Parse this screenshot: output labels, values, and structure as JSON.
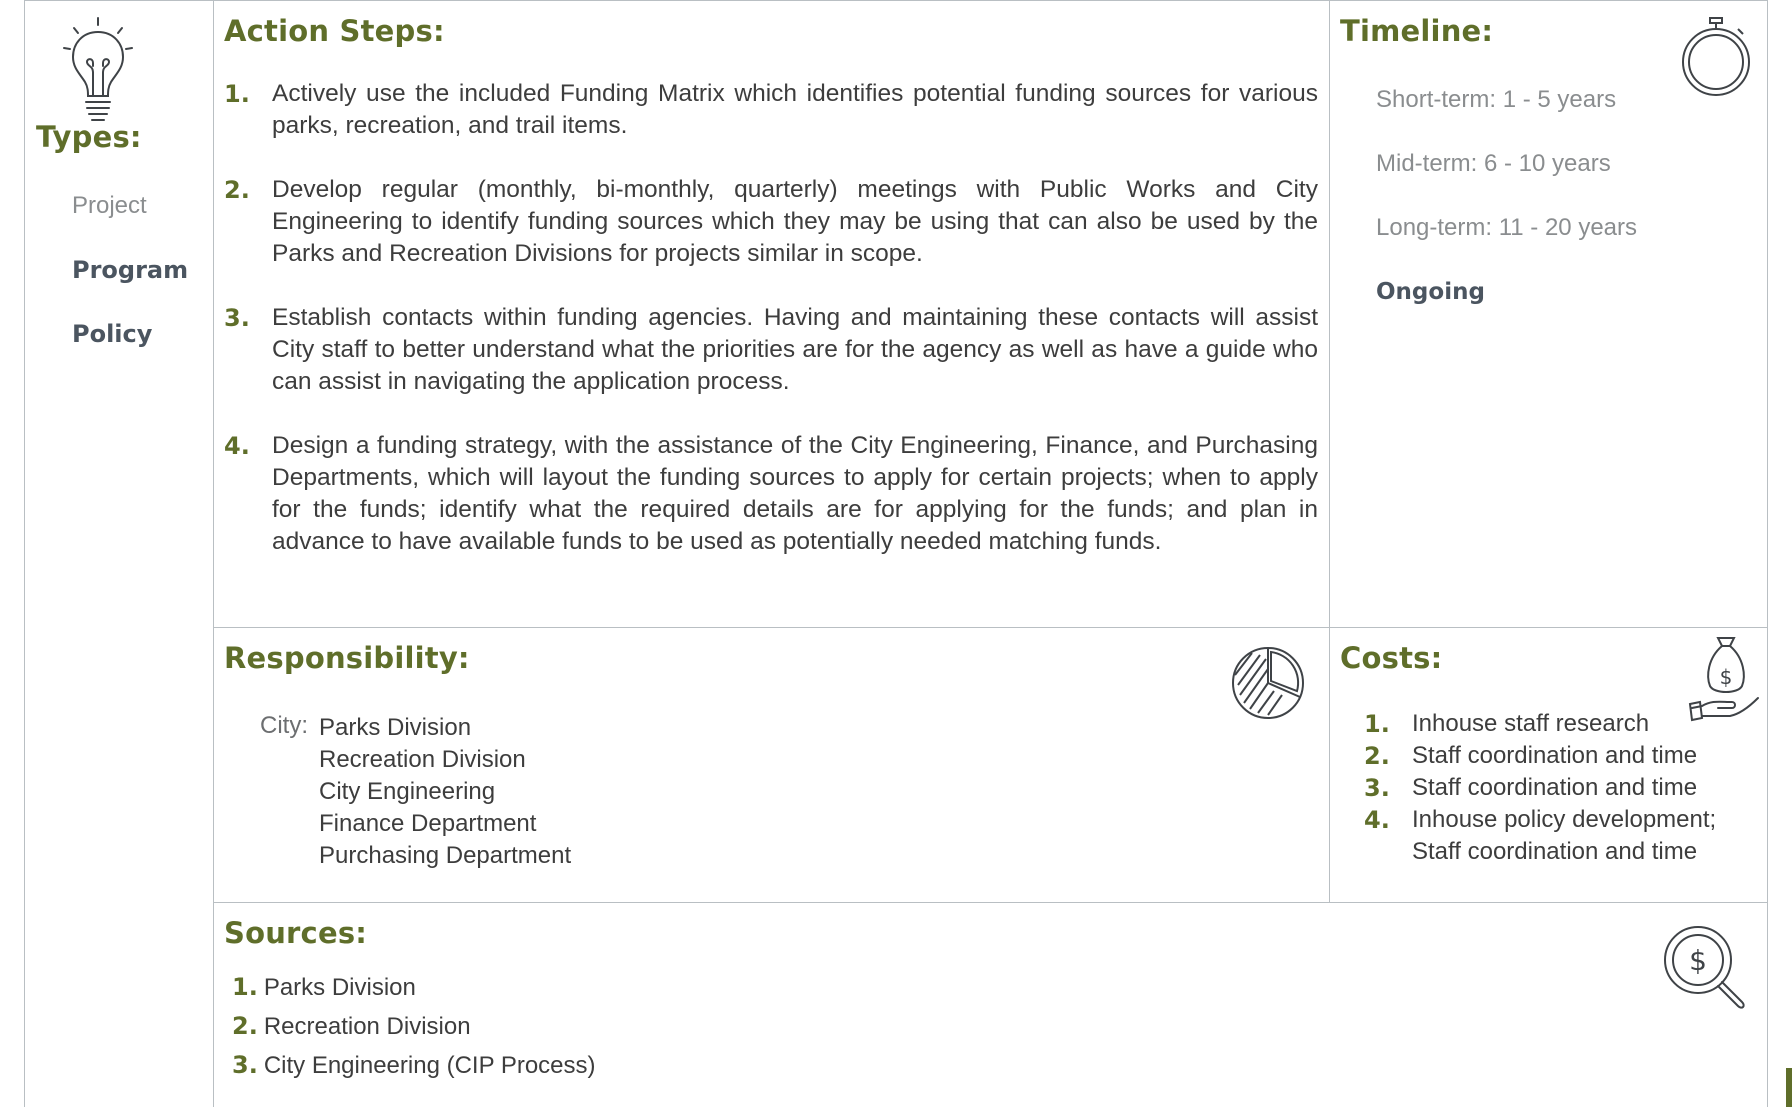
{
  "types": {
    "heading": "Types:",
    "items": [
      {
        "label": "Project",
        "selected": false
      },
      {
        "label": "Program",
        "selected": true
      },
      {
        "label": "Policy",
        "selected": true
      }
    ]
  },
  "action_steps": {
    "heading": "Action Steps:",
    "items": [
      {
        "num": "1.",
        "text": "Actively use the included Funding Matrix which identifies potential funding sources for various parks, recreation, and trail items."
      },
      {
        "num": "2.",
        "text": "Develop regular (monthly, bi-monthly, quarterly) meetings with Public Works and City Engineering to identify funding sources which they may be using that can also be used by the Parks and Recreation Divisions for projects similar in scope."
      },
      {
        "num": "3.",
        "text": "Establish contacts within funding agencies. Having and maintaining these contacts will assist City staff to better understand what the priorities are for the agency as well as have a guide who can assist in navigating the application process."
      },
      {
        "num": "4.",
        "text": "Design a funding strategy, with the assistance of the City Engineering, Finance, and Purchasing Departments, which will layout the funding sources to apply for certain projects; when to apply for the funds; identify what the required details are for applying for the funds; and plan in advance to have available funds to be used as potentially needed matching funds."
      }
    ]
  },
  "timeline": {
    "heading": "Timeline:",
    "items": [
      {
        "label": "Short-term: 1 - 5 years",
        "selected": false
      },
      {
        "label": "Mid-term:  6 - 10 years",
        "selected": false
      },
      {
        "label": "Long-term:  11 - 20 years",
        "selected": false
      },
      {
        "label": "Ongoing",
        "selected": true
      }
    ]
  },
  "responsibility": {
    "heading": "Responsibility:",
    "label": "City:",
    "items": [
      "Parks Division",
      "Recreation Division",
      "City Engineering",
      "Finance Department",
      "Purchasing Department"
    ]
  },
  "costs": {
    "heading": "Costs:",
    "items": [
      {
        "num": "1.",
        "text": "Inhouse staff research"
      },
      {
        "num": "2.",
        "text": "Staff coordination and time"
      },
      {
        "num": "3.",
        "text": "Staff coordination and time"
      },
      {
        "num": "4.",
        "text": "Inhouse policy development;"
      },
      {
        "num": "",
        "text": "Staff coordination and time"
      }
    ]
  },
  "sources": {
    "heading": "Sources:",
    "items": [
      {
        "num": "1.",
        "text": "Parks Division"
      },
      {
        "num": "2.",
        "text": "Recreation Division"
      },
      {
        "num": "3.",
        "text": "City Engineering (CIP Process)"
      }
    ]
  },
  "icons": {
    "types": "lightbulb-icon",
    "timeline": "stopwatch-icon",
    "responsibility": "pie-chart-icon",
    "costs": "money-bag-hand-icon",
    "sources": "dollar-magnifier-icon"
  },
  "colors": {
    "heading": "#5f6e2a",
    "body_text": "#3d3d3d",
    "muted_text": "#8a8d8f",
    "selected_text": "#4b5560",
    "grid": "#b9bfc3"
  }
}
